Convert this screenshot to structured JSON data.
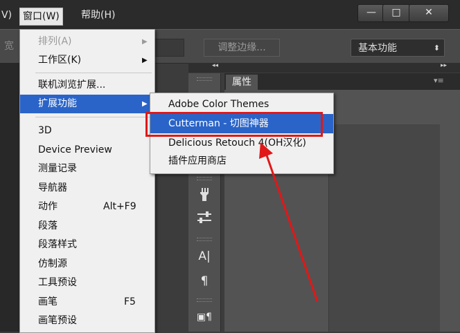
{
  "menubar": {
    "view_partial": "V)",
    "window": "窗口(W)",
    "help": "帮助(H)"
  },
  "window_controls": {
    "minimize": "—",
    "maximize": "□",
    "close": "✕"
  },
  "options_bar": {
    "width_label": "宽",
    "refine_edge": "调整边缘...",
    "workspace": "基本功能",
    "workspace_chevron": "⬍"
  },
  "dock": {
    "collapse_left": "◂◂",
    "collapse_right": "▸▸",
    "panel_tab": "属性",
    "panel_menu": "▾≡"
  },
  "window_menu": {
    "items": [
      {
        "label": "排列(A)",
        "submenu": "▶",
        "disabled": true
      },
      {
        "label": "工作区(K)",
        "submenu": "▶"
      },
      {
        "label": "联机浏览扩展..."
      },
      {
        "label": "扩展功能",
        "submenu": "▶",
        "active": true
      },
      {
        "label": "3D"
      },
      {
        "label": "Device Preview"
      },
      {
        "label": "测量记录"
      },
      {
        "label": "导航器"
      },
      {
        "label": "动作",
        "shortcut": "Alt+F9"
      },
      {
        "label": "段落"
      },
      {
        "label": "段落样式"
      },
      {
        "label": "仿制源"
      },
      {
        "label": "工具预设"
      },
      {
        "label": "画笔",
        "shortcut": "F5"
      },
      {
        "label": "画笔预设"
      }
    ]
  },
  "extensions_submenu": {
    "items": [
      {
        "label": "Adobe Color Themes"
      },
      {
        "label": "Cutterman - 切图神器",
        "active": true
      },
      {
        "label": "Delicious Retouch 4(OH汉化)"
      },
      {
        "label": "插件应用商店"
      }
    ]
  },
  "colors": {
    "highlight": "#2a64c8",
    "annotation": "#e01818"
  }
}
